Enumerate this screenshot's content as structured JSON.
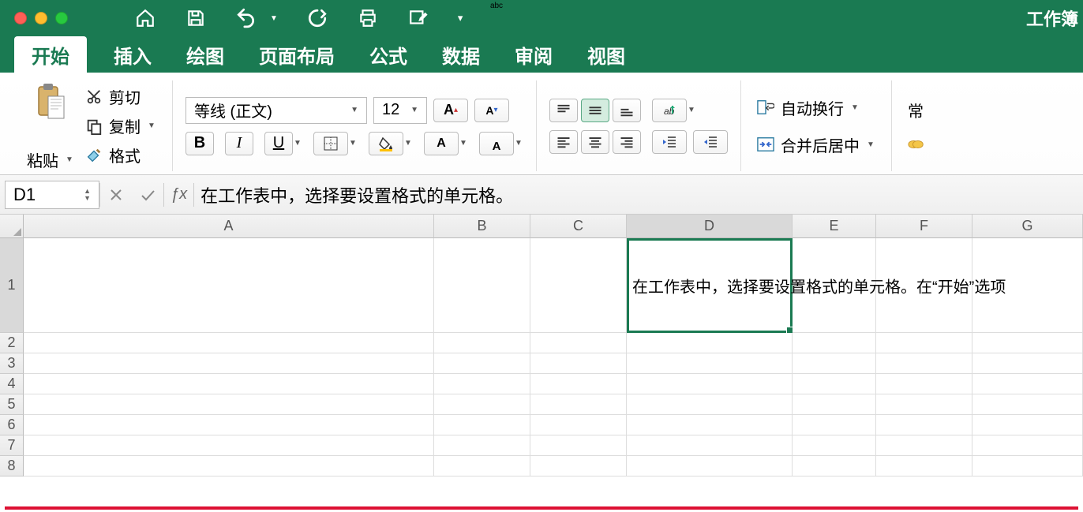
{
  "window": {
    "title": "工作簿"
  },
  "tabs": [
    "开始",
    "插入",
    "绘图",
    "页面布局",
    "公式",
    "数据",
    "审阅",
    "视图"
  ],
  "active_tab": 0,
  "clipboard": {
    "paste": "粘贴",
    "cut": "剪切",
    "copy": "复制",
    "format": "格式"
  },
  "font": {
    "name": "等线 (正文)",
    "size": "12"
  },
  "alignment": {
    "wrap": "自动换行",
    "merge": "合并后居中"
  },
  "number_format": {
    "general": "常"
  },
  "name_box": "D1",
  "formula_bar": "在工作表中，选择要设置格式的单元格。",
  "columns": [
    "A",
    "B",
    "C",
    "D",
    "E",
    "F",
    "G"
  ],
  "selected_column_index": 3,
  "selected_row": 1,
  "row_numbers": [
    1,
    2,
    3,
    4,
    5,
    6,
    7,
    8
  ],
  "cells": {
    "D1_overflow": "在工作表中，选择要设置格式的单元格。在“开始”选项"
  }
}
